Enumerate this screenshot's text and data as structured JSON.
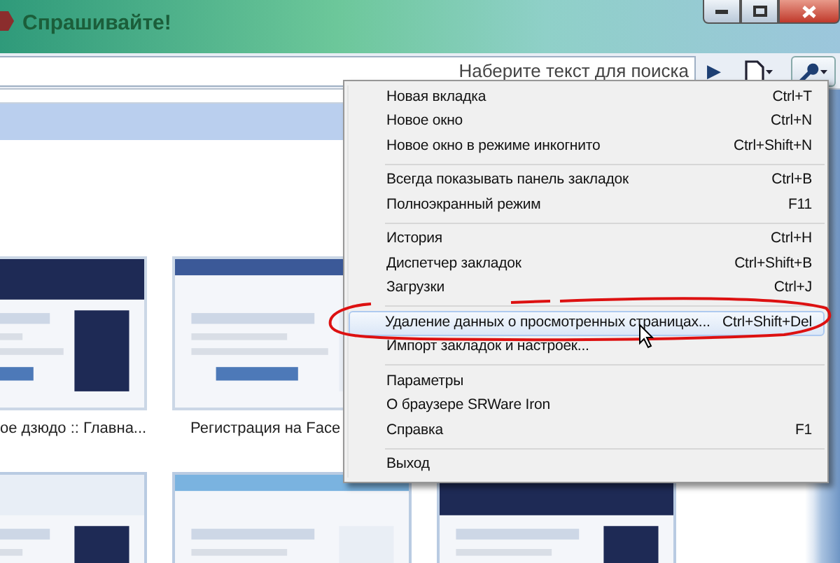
{
  "window": {
    "title": "Спрашивайте!"
  },
  "search": {
    "placeholder": "Наберите текст для поиска",
    "go": "▶"
  },
  "thumbnails": [
    {
      "caption": "ое дзюдо :: Главна..."
    },
    {
      "caption": "Регистрация на Face"
    },
    {
      "kind": "picture"
    },
    {
      "kind": "picture"
    },
    {
      "kind": "picture"
    }
  ],
  "menu": {
    "groups": [
      [
        {
          "label": "Новая вкладка",
          "shortcut": "Ctrl+T",
          "selected": false
        },
        {
          "label": "Новое окно",
          "shortcut": "Ctrl+N",
          "selected": false
        },
        {
          "label": "Новое окно в режиме инкогнито",
          "shortcut": "Ctrl+Shift+N",
          "selected": false
        }
      ],
      [
        {
          "label": "Всегда показывать панель закладок",
          "shortcut": "Ctrl+B",
          "selected": false
        },
        {
          "label": "Полноэкранный режим",
          "shortcut": "F11",
          "selected": false
        }
      ],
      [
        {
          "label": "История",
          "shortcut": "Ctrl+H",
          "selected": false
        },
        {
          "label": "Диспетчер закладок",
          "shortcut": "Ctrl+Shift+B",
          "selected": false
        },
        {
          "label": "Загрузки",
          "shortcut": "Ctrl+J",
          "selected": false
        }
      ],
      [
        {
          "label": "Удаление данных о просмотренных страницах...",
          "shortcut": "Ctrl+Shift+Del",
          "selected": true
        },
        {
          "label": "Импорт закладок и настроек...",
          "selected": false
        }
      ],
      [
        {
          "label": "Параметры",
          "selected": false
        },
        {
          "label": "О браузере SRWare Iron",
          "selected": false
        },
        {
          "label": "Справка",
          "shortcut": "F1",
          "selected": false
        }
      ],
      [
        {
          "label": "Выход",
          "selected": false
        }
      ]
    ]
  }
}
